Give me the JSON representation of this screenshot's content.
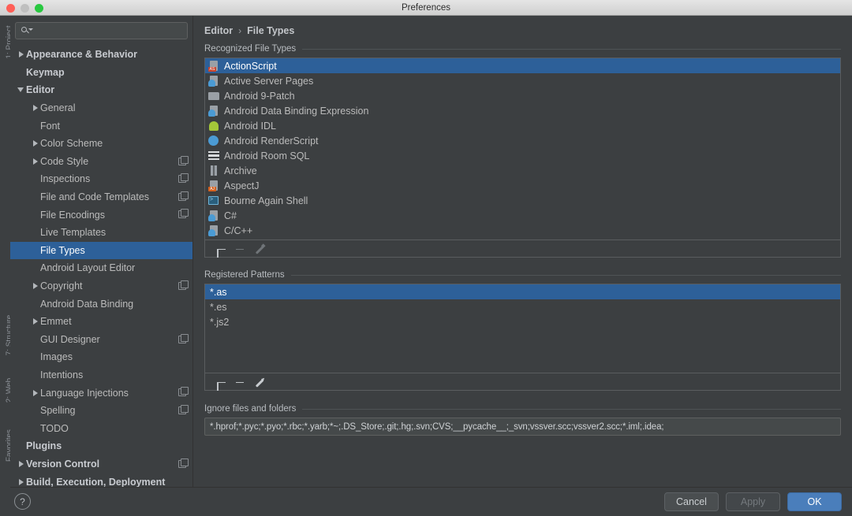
{
  "window": {
    "title": "Preferences",
    "traffic_lights": [
      "close-red",
      "minimize-gray",
      "zoom-green"
    ]
  },
  "ide_backdrop": {
    "strip_labels": [
      "1: Project",
      "7: Structure",
      "2: Web",
      "Favorites"
    ]
  },
  "sidebar": {
    "search": {
      "value": "",
      "placeholder": "",
      "icon": "search-icon"
    },
    "items": [
      {
        "label": "Appearance & Behavior",
        "twisty": "collapsed",
        "indent": 0,
        "bold": true,
        "selected": false,
        "badge": false
      },
      {
        "label": "Keymap",
        "twisty": "none",
        "indent": 0,
        "bold": true,
        "selected": false,
        "badge": false
      },
      {
        "label": "Editor",
        "twisty": "expanded",
        "indent": 0,
        "bold": true,
        "selected": false,
        "badge": false
      },
      {
        "label": "General",
        "twisty": "collapsed",
        "indent": 1,
        "bold": false,
        "selected": false,
        "badge": false
      },
      {
        "label": "Font",
        "twisty": "none",
        "indent": 1,
        "bold": false,
        "selected": false,
        "badge": false
      },
      {
        "label": "Color Scheme",
        "twisty": "collapsed",
        "indent": 1,
        "bold": false,
        "selected": false,
        "badge": false
      },
      {
        "label": "Code Style",
        "twisty": "collapsed",
        "indent": 1,
        "bold": false,
        "selected": false,
        "badge": true
      },
      {
        "label": "Inspections",
        "twisty": "none",
        "indent": 1,
        "bold": false,
        "selected": false,
        "badge": true
      },
      {
        "label": "File and Code Templates",
        "twisty": "none",
        "indent": 1,
        "bold": false,
        "selected": false,
        "badge": true
      },
      {
        "label": "File Encodings",
        "twisty": "none",
        "indent": 1,
        "bold": false,
        "selected": false,
        "badge": true
      },
      {
        "label": "Live Templates",
        "twisty": "none",
        "indent": 1,
        "bold": false,
        "selected": false,
        "badge": false
      },
      {
        "label": "File Types",
        "twisty": "none",
        "indent": 1,
        "bold": false,
        "selected": true,
        "badge": false
      },
      {
        "label": "Android Layout Editor",
        "twisty": "none",
        "indent": 1,
        "bold": false,
        "selected": false,
        "badge": false
      },
      {
        "label": "Copyright",
        "twisty": "collapsed",
        "indent": 1,
        "bold": false,
        "selected": false,
        "badge": true
      },
      {
        "label": "Android Data Binding",
        "twisty": "none",
        "indent": 1,
        "bold": false,
        "selected": false,
        "badge": false
      },
      {
        "label": "Emmet",
        "twisty": "collapsed",
        "indent": 1,
        "bold": false,
        "selected": false,
        "badge": false
      },
      {
        "label": "GUI Designer",
        "twisty": "none",
        "indent": 1,
        "bold": false,
        "selected": false,
        "badge": true
      },
      {
        "label": "Images",
        "twisty": "none",
        "indent": 1,
        "bold": false,
        "selected": false,
        "badge": false
      },
      {
        "label": "Intentions",
        "twisty": "none",
        "indent": 1,
        "bold": false,
        "selected": false,
        "badge": false
      },
      {
        "label": "Language Injections",
        "twisty": "collapsed",
        "indent": 1,
        "bold": false,
        "selected": false,
        "badge": true
      },
      {
        "label": "Spelling",
        "twisty": "none",
        "indent": 1,
        "bold": false,
        "selected": false,
        "badge": true
      },
      {
        "label": "TODO",
        "twisty": "none",
        "indent": 1,
        "bold": false,
        "selected": false,
        "badge": false
      },
      {
        "label": "Plugins",
        "twisty": "none",
        "indent": 0,
        "bold": true,
        "selected": false,
        "badge": false
      },
      {
        "label": "Version Control",
        "twisty": "collapsed",
        "indent": 0,
        "bold": true,
        "selected": false,
        "badge": true
      },
      {
        "label": "Build, Execution, Deployment",
        "twisty": "collapsed",
        "indent": 0,
        "bold": true,
        "selected": false,
        "badge": false
      }
    ]
  },
  "content": {
    "breadcrumb": {
      "parent": "Editor",
      "separator": "›",
      "current": "File Types"
    },
    "recognized": {
      "section_title": "Recognized File Types",
      "items": [
        {
          "label": "ActionScript",
          "icon": "actionscript-file-icon",
          "selected": true
        },
        {
          "label": "Active Server Pages",
          "icon": "asp-file-icon",
          "selected": false
        },
        {
          "label": "Android 9-Patch",
          "icon": "folder-file-icon",
          "selected": false
        },
        {
          "label": "Android Data Binding Expression",
          "icon": "databinding-file-icon",
          "selected": false
        },
        {
          "label": "Android IDL",
          "icon": "android-robot-icon",
          "selected": false
        },
        {
          "label": "Android RenderScript",
          "icon": "renderscript-file-icon",
          "selected": false
        },
        {
          "label": "Android Room SQL",
          "icon": "sql-table-icon",
          "selected": false
        },
        {
          "label": "Archive",
          "icon": "archive-file-icon",
          "selected": false
        },
        {
          "label": "AspectJ",
          "icon": "aspectj-file-icon",
          "selected": false
        },
        {
          "label": "Bourne Again Shell",
          "icon": "shell-terminal-icon",
          "selected": false
        },
        {
          "label": "C#",
          "icon": "csharp-file-icon",
          "selected": false
        },
        {
          "label": "C/C++",
          "icon": "cpp-file-icon",
          "selected": false
        }
      ],
      "toolbar": [
        {
          "name": "add-file-type-button",
          "icon": "plus-icon",
          "enabled": true
        },
        {
          "name": "remove-file-type-button",
          "icon": "minus-icon",
          "enabled": false
        },
        {
          "name": "edit-file-type-button",
          "icon": "pencil-icon",
          "enabled": false
        }
      ]
    },
    "patterns": {
      "section_title": "Registered Patterns",
      "items": [
        {
          "label": "*.as",
          "selected": true
        },
        {
          "label": "*.es",
          "selected": false
        },
        {
          "label": "*.js2",
          "selected": false
        }
      ],
      "toolbar": [
        {
          "name": "add-pattern-button",
          "icon": "plus-icon",
          "enabled": true
        },
        {
          "name": "remove-pattern-button",
          "icon": "minus-icon",
          "enabled": true
        },
        {
          "name": "edit-pattern-button",
          "icon": "pencil-icon",
          "enabled": true
        }
      ]
    },
    "ignore": {
      "section_title": "Ignore files and folders",
      "value_prefix": "*.hprof;*.pyc;*.pyo;*.rbc;*.yarb;*~;.DS_Store;.git;.hg;.svn;CVS;__pycache__;_svn;vssver.scc;vssver2.scc;",
      "value_highlighted": "*.iml;.idea;",
      "full_value": "*.hprof;*.pyc;*.pyo;*.rbc;*.yarb;*~;.DS_Store;.git;.hg;.svn;CVS;__pycache__;_svn;vssver.scc;vssver2.scc;*.iml;.idea;",
      "annotation_color": "#e8512a"
    }
  },
  "footer": {
    "help_label": "?",
    "buttons": [
      {
        "label": "Cancel",
        "name": "cancel-button",
        "style": "normal",
        "enabled": true
      },
      {
        "label": "Apply",
        "name": "apply-button",
        "style": "disabled",
        "enabled": false
      },
      {
        "label": "OK",
        "name": "ok-button",
        "style": "primary",
        "enabled": true
      }
    ]
  }
}
